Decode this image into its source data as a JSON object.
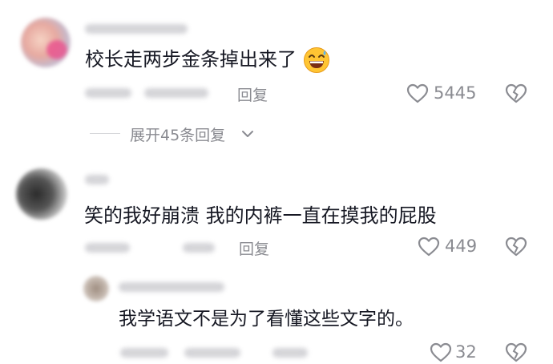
{
  "comments": [
    {
      "text": "校长走两步金条掉出来了",
      "emoji": "grinning-sweat-emoji",
      "reply_label": "回复",
      "like_count": "5445"
    },
    {
      "text": "笑的我好崩溃 我的内裤一直在摸我的屁股",
      "reply_label": "回复",
      "like_count": "449"
    },
    {
      "text": "我学语文不是为了看懂这些文字的。",
      "like_count": "32"
    }
  ],
  "expand_replies": "展开45条回复",
  "colors": {
    "text": "#161823",
    "secondary": "#8a8b91",
    "heart_outline": "#8a8b91",
    "emoji_face": "#ffc533"
  }
}
